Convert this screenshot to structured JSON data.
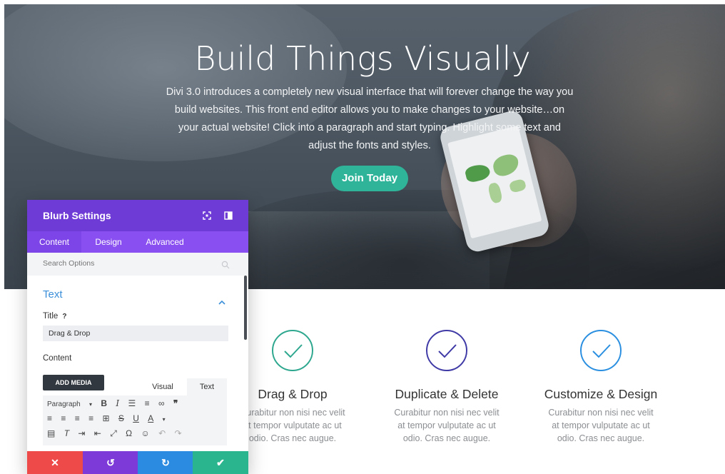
{
  "hero": {
    "title": "Build Things Visually",
    "body": "Divi 3.0 introduces a completely new visual interface that will forever change the way you build websites. This front end editor allows you to make changes to your website…on your actual website! Click into a paragraph and start typing. Highlight some text and adjust the fonts and styles.",
    "cta_label": "Join Today",
    "cta_color": "#2fb49a"
  },
  "features": [
    {
      "title": "Drag & Drop",
      "text": "Curabitur non nisi nec velit at tempor vulputate ac ut odio. Cras nec augue.",
      "icon": "check-circle-icon",
      "color": "#2ea78f"
    },
    {
      "title": "Duplicate & Delete",
      "text": "Curabitur non nisi nec velit at tempor vulputate ac ut odio. Cras nec augue.",
      "icon": "check-circle-icon",
      "color": "#3f3aa6"
    },
    {
      "title": "Customize & Design",
      "text": "Curabitur non nisi nec velit at tempor vulputate ac ut odio. Cras nec augue.",
      "icon": "check-circle-icon",
      "color": "#2a8fe0"
    }
  ],
  "panel": {
    "title": "Blurb Settings",
    "header_color": "#6f3bd6",
    "tabs": [
      {
        "label": "Content"
      },
      {
        "label": "Design"
      },
      {
        "label": "Advanced"
      }
    ],
    "search_placeholder": "Search Options",
    "section_title": "Text",
    "title_label": "Title",
    "help_glyph": "?",
    "title_value": "Drag & Drop",
    "content_label": "Content",
    "add_media_label": "ADD MEDIA",
    "editor_tabs": [
      "Visual",
      "Text"
    ],
    "paragraph_select": "Paragraph",
    "footer_colors": [
      "#ef4a4a",
      "#7d3ad8",
      "#2b8be0",
      "#2bb58f"
    ]
  }
}
